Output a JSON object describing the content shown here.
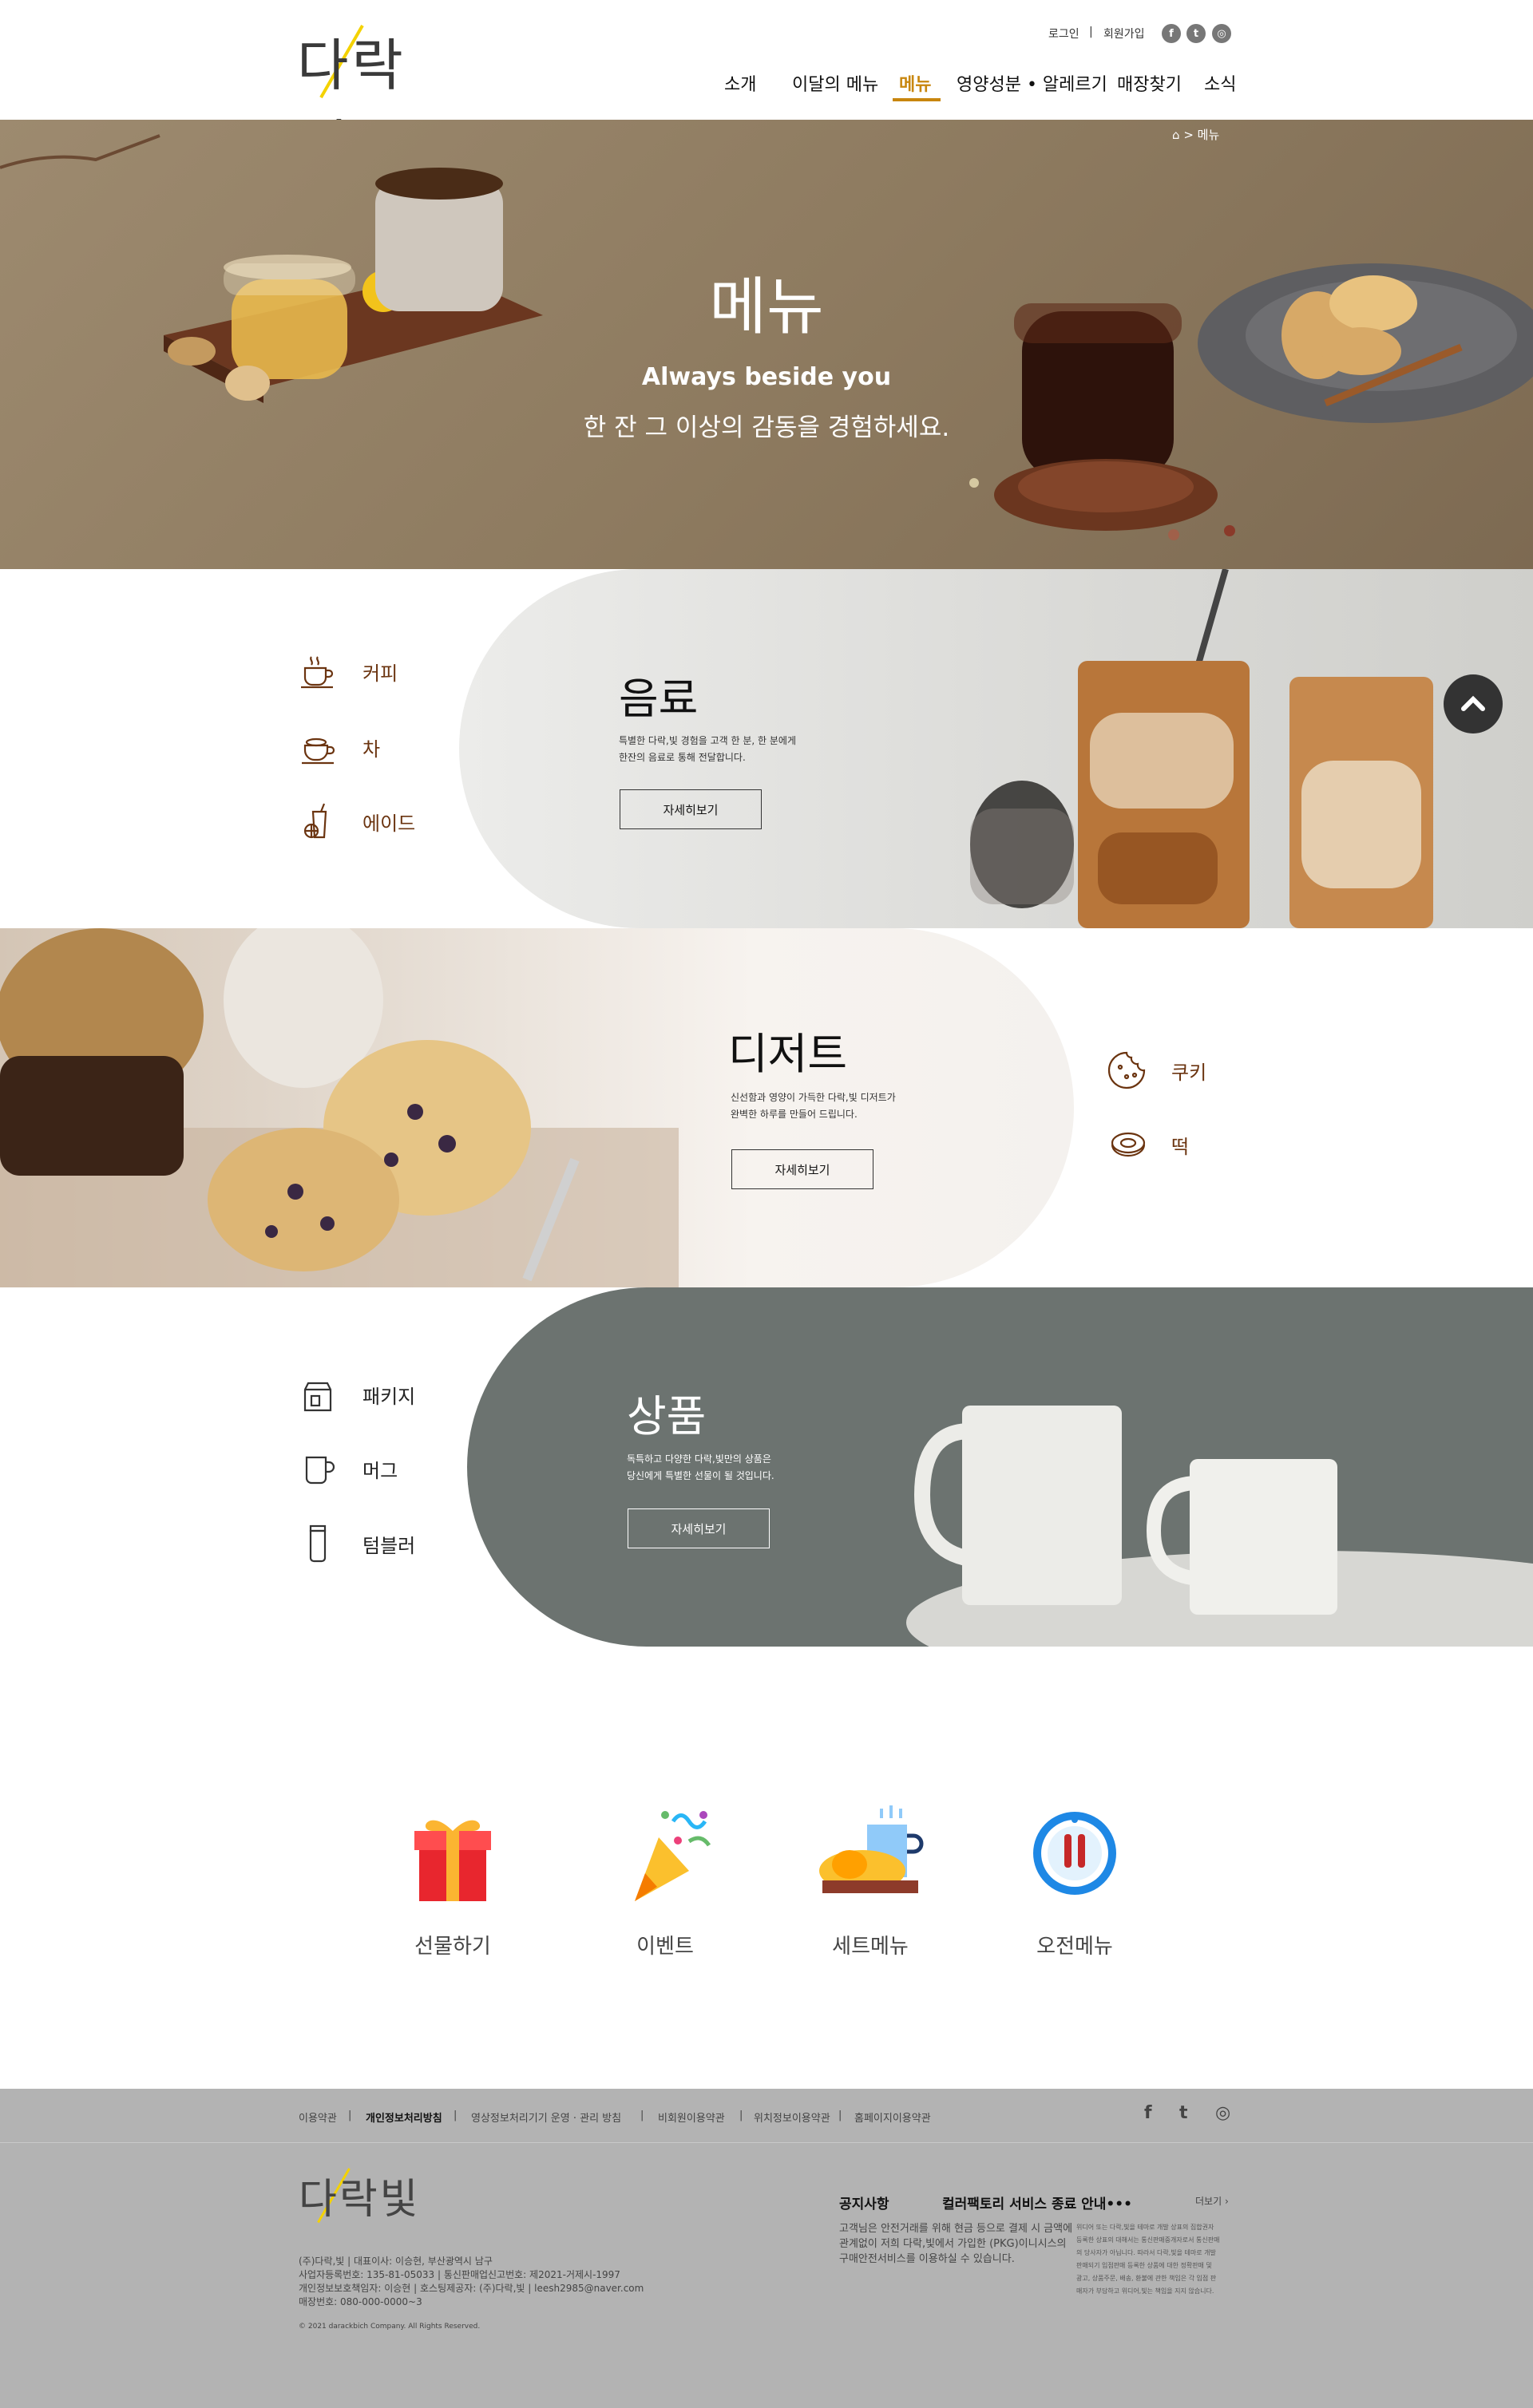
{
  "header": {
    "logo_text": "다락빛",
    "util": {
      "login": "로그인",
      "sep": "|",
      "signup": "회원가입"
    },
    "sns": [
      {
        "icon": "facebook-icon",
        "glyph": "f"
      },
      {
        "icon": "twitter-icon",
        "glyph": "t"
      },
      {
        "icon": "instagram-icon",
        "glyph": "◎"
      }
    ],
    "nav": [
      {
        "label": "소개",
        "active": false
      },
      {
        "label": "이달의 메뉴",
        "active": false
      },
      {
        "label": "메뉴",
        "active": true
      },
      {
        "label": "영양성분 • 알레르기",
        "active": false
      },
      {
        "label": "매장찾기",
        "active": false
      },
      {
        "label": "소식",
        "active": false
      }
    ],
    "accent_color": "#c8860e"
  },
  "hero": {
    "breadcrumb": {
      "separator": ">",
      "current": "메뉴"
    },
    "title": "메뉴",
    "subtitle_en": "Always beside you",
    "subtitle_ko": "한 잔 그 이상의 감동을 경험하세요."
  },
  "sections": [
    {
      "id": "drink",
      "categories": [
        {
          "label": "커피",
          "icon": "coffee-cup-icon"
        },
        {
          "label": "차",
          "icon": "teapot-icon"
        },
        {
          "label": "에이드",
          "icon": "ade-drink-icon"
        }
      ],
      "title": "음료",
      "desc_lines": [
        "특별한 다락,빛 경험을 고객 한 분, 한 분에게",
        "한잔의 음료로 통해 전달합니다."
      ],
      "button": "자세히보기"
    },
    {
      "id": "dessert",
      "categories": [
        {
          "label": "쿠키",
          "icon": "cookie-icon"
        },
        {
          "label": "떡",
          "icon": "rice-cake-icon"
        }
      ],
      "title": "디저트",
      "desc_lines": [
        "신선함과 영양이 가득한 다락,빛 디저트가",
        "완벽한 하루를 만들어 드립니다."
      ],
      "button": "자세히보기"
    },
    {
      "id": "goods",
      "categories": [
        {
          "label": "패키지",
          "icon": "package-icon"
        },
        {
          "label": "머그",
          "icon": "mug-icon"
        },
        {
          "label": "텀블러",
          "icon": "tumbler-icon"
        }
      ],
      "title": "상품",
      "desc_lines": [
        "독특하고 다양한 다락,빛만의 상품은",
        "당신에게 특별한 선물이 될 것입니다."
      ],
      "button": "자세히보기"
    }
  ],
  "quick_menu": [
    {
      "label": "선물하기",
      "icon": "gift-icon"
    },
    {
      "label": "이벤트",
      "icon": "party-popper-icon"
    },
    {
      "label": "세트메뉴",
      "icon": "set-menu-icon"
    },
    {
      "label": "오전메뉴",
      "icon": "morning-menu-icon"
    }
  ],
  "footer": {
    "links": [
      "이용약관",
      "개인정보처리방침",
      "영상정보처리기기 운영 · 관리 방침",
      "비회원이용약관",
      "위치정보이용약관",
      "홈페이지이용약관"
    ],
    "sep": "|",
    "sns_glyphs": [
      "f",
      "t",
      "◎"
    ],
    "logo_text": "다락빛",
    "company_lines": [
      "(주)다락,빛  |  대표이사: 이승현, 부산광역시 남구",
      "사업자등록번호: 135-81-05033  |  통신판매업신고번호: 제2021-거제시-1997",
      "개인정보보호책임자: 이승현  |  호스팅제공자: (주)다락,빛  |  leesh2985@naver.com",
      "매장번호: 080-000-0000~3"
    ],
    "copyright": "© 2021 darackbich Company. All Rights Reserved.",
    "notice": {
      "label": "공지사항",
      "title": "컬러팩토리 서비스 종료 안내•••",
      "more": "더보기",
      "body_lines": [
        "고객님은 안전거래를 위해 현금 등으로 결제 시 금액에",
        "관계없이 저희 다락,빛에서 가입한 (PKG)이니시스의",
        "구매안전서비스를 이용하실 수 있습니다."
      ],
      "small_lines": [
        "위디어 또는 다락,빛을 테마로 개발 상표의 집합권자",
        "등록한 상표의 대해서는 통신판매중개자로서 통신판매",
        "의 당사자가 아닙니다. 따라서 다락,빛을 테마로 개발",
        "판매되기 입점판매 등록한 상품에 대한 정확판매 및",
        "광고, 상품주문, 배송, 환불에 관한 책임은 각 입점 판",
        "매자가 부담하고 위디어,빛는 책임을 지지 않습니다."
      ]
    }
  }
}
